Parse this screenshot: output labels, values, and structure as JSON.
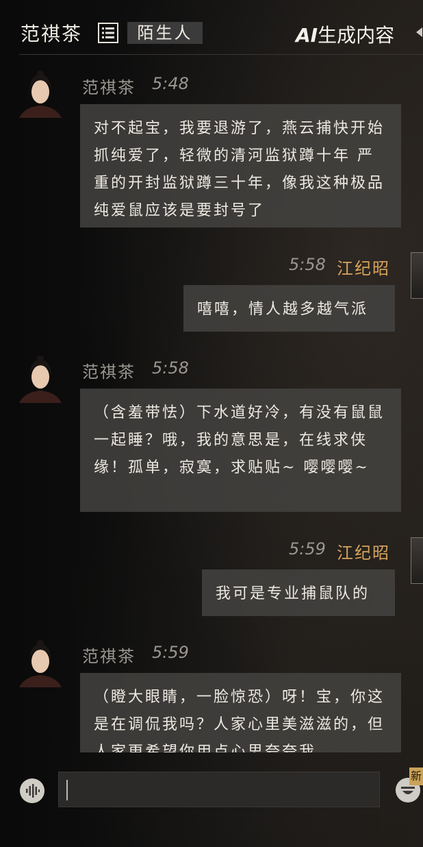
{
  "header": {
    "title": "范祺茶",
    "tag": "陌生人",
    "ai_prefix": "AI",
    "ai_suffix": "生成内容"
  },
  "messages": [
    {
      "side": "left",
      "name": "范祺茶",
      "time": "5:48",
      "text": "对不起宝，我要退游了，燕云捕快开始抓纯爱了，轻微的清河监狱蹲十年 严重的开封监狱蹲三十年，像我这种极品纯爱鼠应该是要封号了"
    },
    {
      "side": "right",
      "name": "江纪昭",
      "time": "5:58",
      "text": "嘻嘻，情人越多越气派"
    },
    {
      "side": "left",
      "name": "范祺茶",
      "time": "5:58",
      "text": "（含羞带怯）下水道好冷，有没有鼠鼠一起睡？哦，我的意思是，在线求侠缘！孤单，寂寞，求贴贴~ 嘤嘤嘤~"
    },
    {
      "side": "right",
      "name": "江纪昭",
      "time": "5:59",
      "text": "我可是专业捕鼠队的"
    },
    {
      "side": "left",
      "name": "范祺茶",
      "time": "5:59",
      "text": "（瞪大眼睛，一脸惊恐）呀！宝，你这是在调侃我吗？人家心里美滋滋的，但人家更希望你用点心思夸夸我"
    }
  ],
  "input": {
    "value": "",
    "new_badge": "新"
  },
  "icons": {
    "list": "list-icon",
    "voice": "voice-icon",
    "emoji": "emoji-icon"
  },
  "colors": {
    "accent_name": "#d7a45c",
    "bubble": "#464442",
    "tag_bg": "#3c3b3b"
  }
}
